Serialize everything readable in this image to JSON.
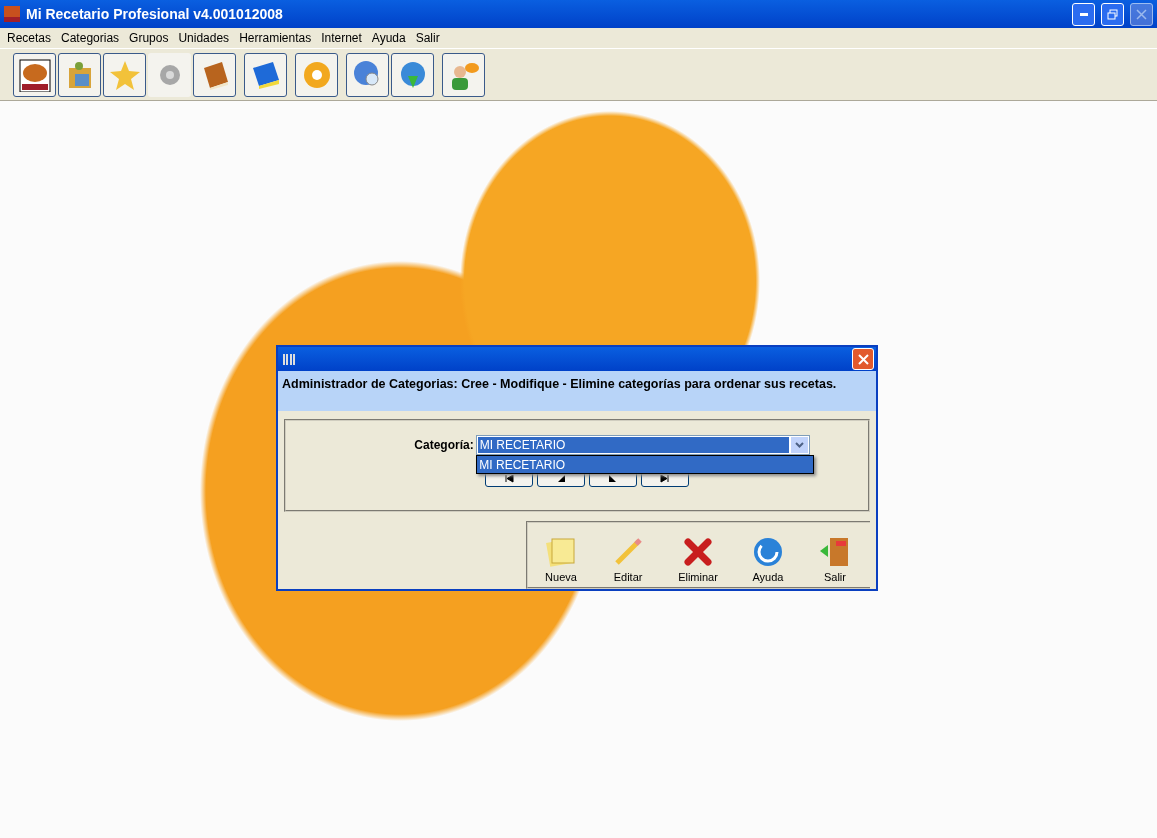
{
  "window": {
    "title": "Mi Recetario Profesional v4.001012008"
  },
  "menu": [
    "Recetas",
    "Categorias",
    "Grupos",
    "Unidades",
    "Herramientas",
    "Internet",
    "Ayuda",
    "Salir"
  ],
  "toolbar": {
    "groups": [
      [
        {
          "disabled": false
        },
        {
          "disabled": false
        },
        {
          "disabled": false
        },
        {
          "disabled": true
        },
        {
          "disabled": false
        }
      ],
      [
        {
          "disabled": false
        }
      ],
      [
        {
          "disabled": false
        }
      ],
      [
        {
          "disabled": false
        },
        {
          "disabled": false
        }
      ],
      [
        {
          "disabled": false
        }
      ]
    ]
  },
  "dialog": {
    "header": "Administrador de Categorias: Cree - Modifique - Elimine categorías para ordenar sus recetas.",
    "category_label": "Categoría:",
    "category_value": "MI RECETARIO",
    "dropdown_open": true,
    "dropdown_items": [
      {
        "label": "MI RECETARIO",
        "selected": true
      }
    ],
    "actions": [
      "Nueva",
      "Editar",
      "Eliminar",
      "Ayuda",
      "Salir"
    ]
  }
}
